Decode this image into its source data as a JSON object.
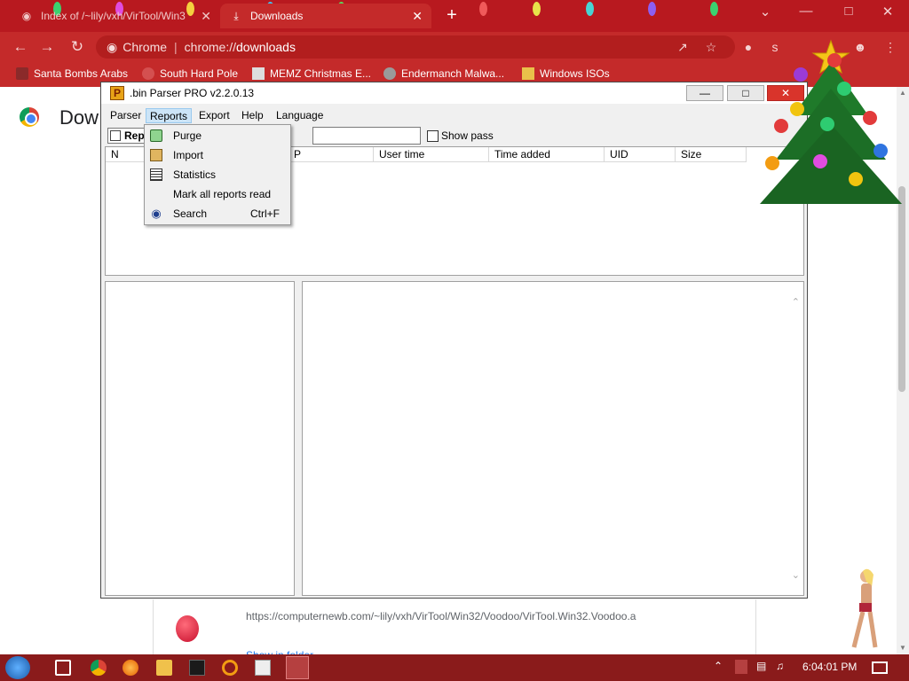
{
  "browser": {
    "tabs": [
      {
        "title": "Index of /~lily/vxh/VirTool/Win3",
        "active": false
      },
      {
        "title": "Downloads",
        "active": true
      }
    ],
    "address": {
      "scheme_label": "Chrome",
      "url_prefix": "chrome://",
      "url_host": "downloads"
    },
    "bookmarks": [
      "Santa Bombs Arabs",
      "South Hard Pole",
      "MEMZ Christmas E...",
      "Endermanch Malwa...",
      "Windows ISOs"
    ],
    "theme_color": "#c42a2a"
  },
  "downloads_page": {
    "heading": "Dow",
    "item_url": "https://computernewb.com/~lily/vxh/VirTool/Win32/Voodoo/VirTool.Win32.Voodoo.a",
    "show_in_folder": "Show in folder"
  },
  "app": {
    "title": ".bin Parser PRO v2.2.0.13",
    "menu": [
      "Parser",
      "Reports",
      "Export",
      "Help",
      "Language"
    ],
    "active_menu": "Reports",
    "toolbar": {
      "reports_button": "Rep",
      "search_value": "",
      "show_pass_label": "Show pass"
    },
    "columns": [
      "N",
      "P",
      "User time",
      "Time added",
      "UID",
      "Size"
    ],
    "reports_menu": [
      {
        "label": "Purge",
        "icon": "recycle-icon",
        "shortcut": ""
      },
      {
        "label": "Import",
        "icon": "import-icon",
        "shortcut": ""
      },
      {
        "label": "Statistics",
        "icon": "statistics-icon",
        "shortcut": ""
      },
      {
        "label": "Mark all reports read",
        "icon": "",
        "shortcut": ""
      },
      {
        "label": "Search",
        "icon": "binoculars-icon",
        "shortcut": "Ctrl+F"
      }
    ]
  },
  "taskbar": {
    "clock": "6:04:01 PM",
    "color": "#8a1b1b"
  }
}
